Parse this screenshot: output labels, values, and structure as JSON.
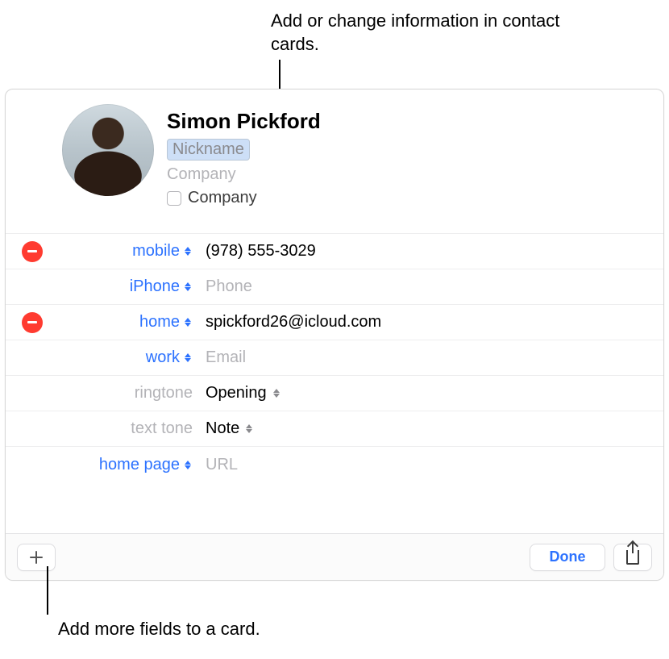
{
  "callouts": {
    "top": "Add or change information in contact cards.",
    "bottom": "Add more fields to a card."
  },
  "contact": {
    "name": "Simon Pickford",
    "nickname_placeholder": "Nickname",
    "company_placeholder": "Company",
    "company_checkbox_label": "Company"
  },
  "rows": {
    "mobile": {
      "label": "mobile",
      "value": "(978) 555-3029"
    },
    "iphone": {
      "label": "iPhone",
      "placeholder": "Phone"
    },
    "home_email": {
      "label": "home",
      "value": "spickford26@icloud.com"
    },
    "work_email": {
      "label": "work",
      "placeholder": "Email"
    },
    "ringtone": {
      "label": "ringtone",
      "value": "Opening"
    },
    "texttone": {
      "label": "text tone",
      "value": "Note"
    },
    "homepage": {
      "label": "home page",
      "placeholder": "URL"
    }
  },
  "footer": {
    "done_label": "Done"
  }
}
